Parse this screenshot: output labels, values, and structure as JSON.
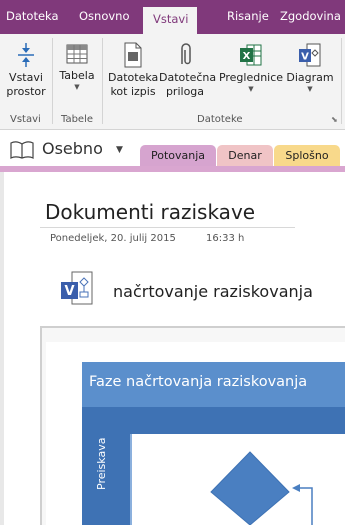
{
  "ribbon_tabs": [
    "Datoteka",
    "Osnovno",
    "Vstavi",
    "Risanje",
    "Zgodovina"
  ],
  "ribbon": {
    "buttons": {
      "vstavi_prostor": "Vstavi prostor",
      "tabela": "Tabela",
      "datoteka_kot_izpis": "Datoteka kot izpis",
      "datotecna_priloga": "Datotečna priloga",
      "preglednice": "Preglednice",
      "diagram": "Diagram"
    },
    "groups": {
      "vstavi": "Vstavi",
      "tabele": "Tabele",
      "datoteke": "Datoteke"
    }
  },
  "notebook": {
    "name": "Osebno",
    "sections": [
      "Potovanja",
      "Denar",
      "Splošno"
    ],
    "colors": {
      "potovanja": "#d6a4cf",
      "denar": "#f0c4c6",
      "splosno": "#f8d98b",
      "active_bar": "#d9a6d0"
    }
  },
  "page": {
    "title": "Dokumenti raziskave",
    "date": "Ponedeljek, 20. julij 2015",
    "time": "16:33 h",
    "attachment": {
      "name": "načrtovanje raziskovanja",
      "icon": "visio-file-icon"
    }
  },
  "diagram": {
    "banner": "Faze načrtovanja raziskovanja",
    "lane": "Preiskava"
  },
  "colors": {
    "onenote_purple": "#80397b",
    "ribbon_bg": "#f3f3f3",
    "diagram_blue": "#5b8fcc",
    "diagram_dark_blue": "#3e72b4"
  }
}
